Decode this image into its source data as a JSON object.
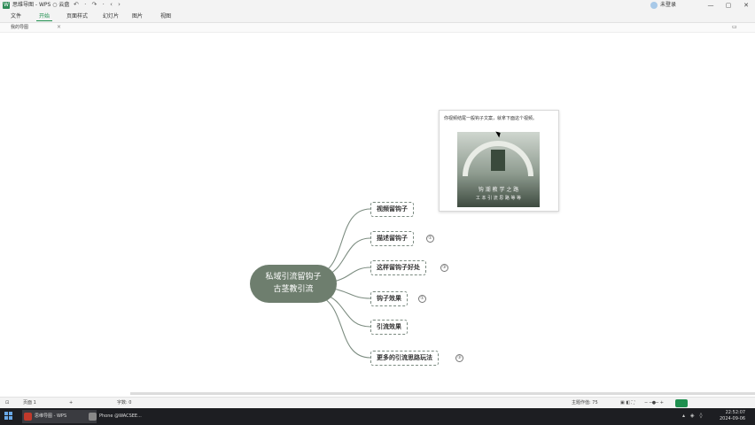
{
  "titlebar": {
    "app_title": "思维导图 - WPS ○ 云盘",
    "quick_access": "↶ · ↷ · ‹ ›",
    "login_label": "未登录",
    "window_controls": [
      "—",
      "▢",
      "✕"
    ]
  },
  "ribbon": {
    "tabs": [
      "文件",
      "开始",
      "页面样式",
      "幻灯片",
      "图片",
      "视图"
    ],
    "active_index": 1
  },
  "doc_tab": {
    "label": "我的导图",
    "close": "×"
  },
  "mindmap": {
    "root": {
      "line1": "私域引流留钩子",
      "line2": "古茎教引流"
    },
    "children": [
      {
        "label": "视频留钩子",
        "badge": ""
      },
      {
        "label": "描述留钩子",
        "badge": "①"
      },
      {
        "label": "这样留钩子好处",
        "badge": "③"
      },
      {
        "label": "钩子效果",
        "badge": "①"
      },
      {
        "label": "引流效果",
        "badge": ""
      },
      {
        "label": "更多的引流思路玩法",
        "badge": "③"
      }
    ]
  },
  "note": {
    "text": "你视频结尾一般钩子文案，就拿下面这个视频。",
    "image_line1": "钩 潮 教 学 之 路",
    "image_line2": "工 本 引 流 思 路 等 等"
  },
  "statusbar": {
    "left_label": "页面 1",
    "add": "+",
    "center_label": "字数: 0",
    "zoom_label": "主题作值: 75",
    "zoom_controls": "− ─●─ +",
    "view_icons": "▣ ◧ ⛶"
  },
  "taskbar": {
    "tasks": [
      "思维导图 - WPS",
      "Phone @WACSEE..."
    ],
    "clock_time": "22:52:07",
    "clock_date": "2024-09-06"
  },
  "colors": {
    "accent": "#1f8f4f",
    "root_fill": "#6e7e6e",
    "edge": "#7c8c80",
    "taskbar": "#1d1e22"
  }
}
